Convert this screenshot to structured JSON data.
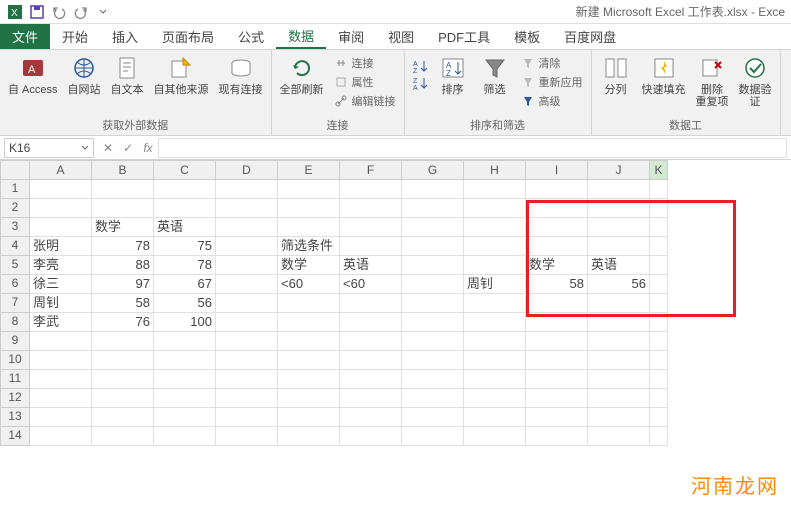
{
  "app_title": "新建 Microsoft Excel 工作表.xlsx - Exce",
  "tabs": {
    "file": "文件",
    "home": "开始",
    "insert": "插入",
    "layout": "页面布局",
    "formulas": "公式",
    "data": "数据",
    "review": "审阅",
    "view": "视图",
    "pdf": "PDF工具",
    "template": "模板",
    "baidu": "百度网盘"
  },
  "ribbon": {
    "ext_data": {
      "access": "自 Access",
      "web": "自网站",
      "text": "自文本",
      "other": "自其他来源",
      "existing": "现有连接",
      "label": "获取外部数据"
    },
    "conn": {
      "refresh": "全部刷新",
      "connections": "连接",
      "properties": "属性",
      "edit_links": "编辑链接",
      "label": "连接"
    },
    "sort": {
      "sort": "排序",
      "filter": "筛选",
      "clear": "清除",
      "reapply": "重新应用",
      "advanced": "高级",
      "label": "排序和筛选"
    },
    "tools": {
      "text_to_col": "分列",
      "flash_fill": "快速填充",
      "remove_dup": "删除\n重复项",
      "data_val": "数据验\n证",
      "label": "数据工"
    }
  },
  "namebox": "K16",
  "formula": "",
  "cols": [
    "A",
    "B",
    "C",
    "D",
    "E",
    "F",
    "G",
    "H",
    "I",
    "J",
    "K"
  ],
  "rows": [
    "1",
    "2",
    "3",
    "4",
    "5",
    "6",
    "7",
    "8",
    "9",
    "10",
    "11",
    "12",
    "13",
    "14"
  ],
  "cells": {
    "B3": "数学",
    "C3": "英语",
    "A4": "张明",
    "B4": "78",
    "C4": "75",
    "E4": "筛选条件",
    "A5": "李亮",
    "B5": "88",
    "C5": "78",
    "E5": "数学",
    "F5": "英语",
    "I5": "数学",
    "J5": "英语",
    "A6": "徐三",
    "B6": "97",
    "C6": "67",
    "E6": "<60",
    "F6": "<60",
    "H6": "周钊",
    "I6": "58",
    "J6": "56",
    "A7": "周钊",
    "B7": "58",
    "C7": "56",
    "A8": "李武",
    "B8": "76",
    "C8": "100"
  },
  "watermark": "河南龙网"
}
